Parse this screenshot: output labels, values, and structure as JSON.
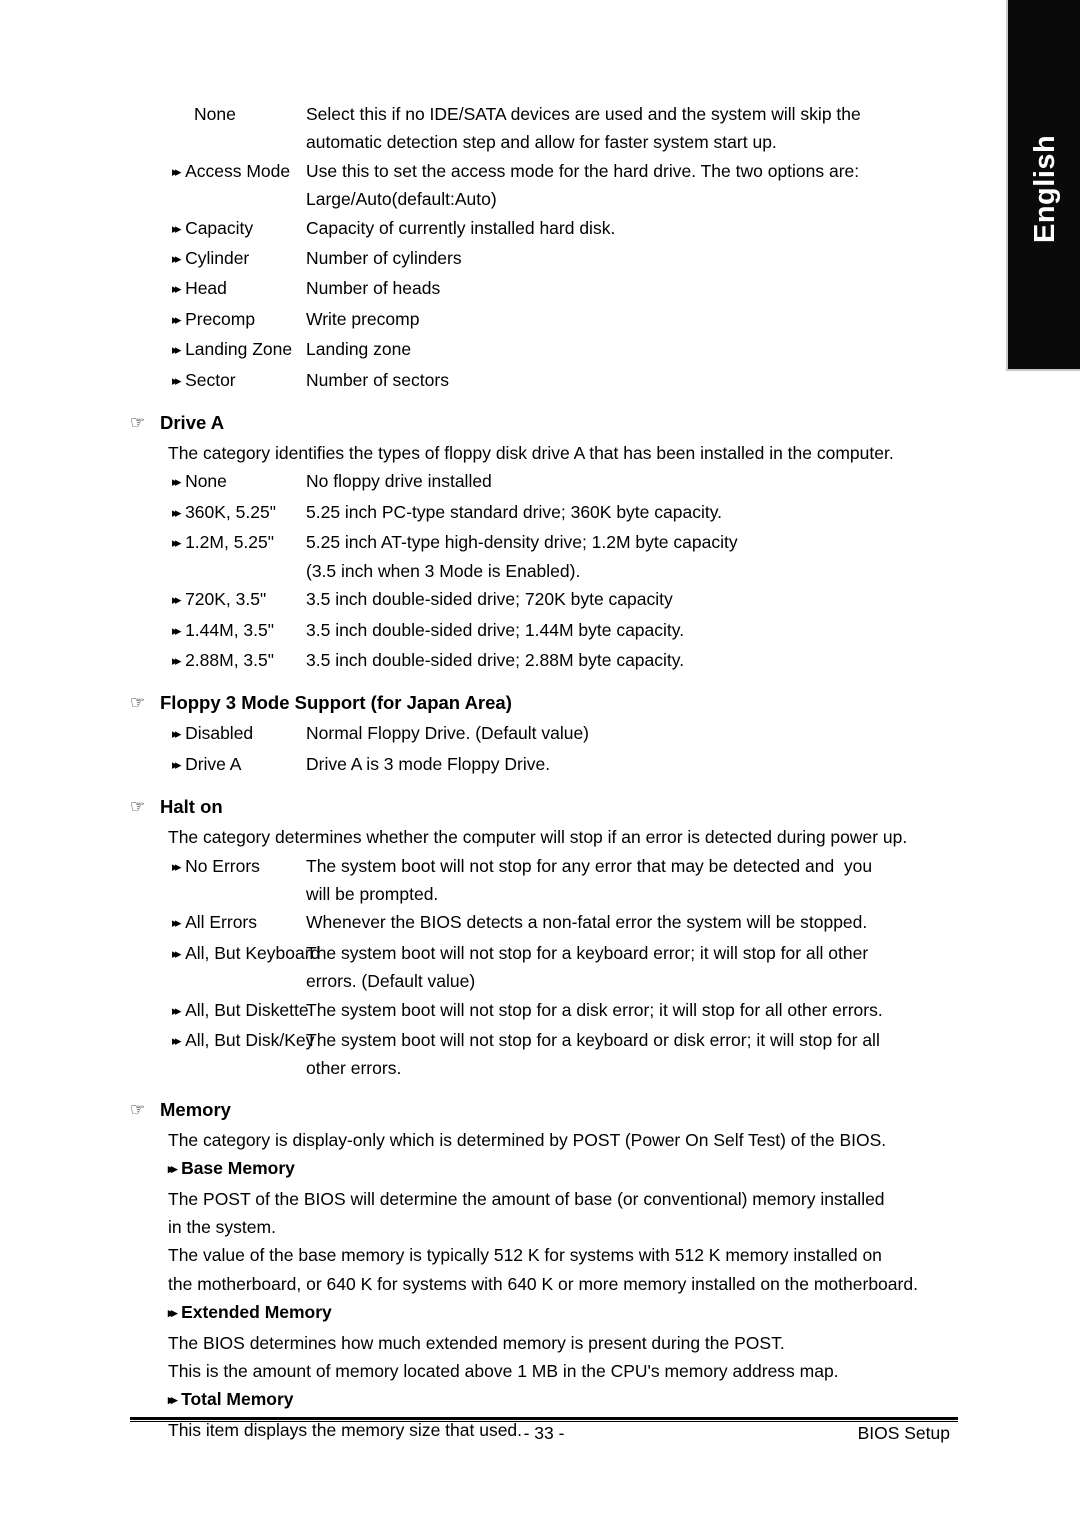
{
  "language_tab": {
    "label": "English"
  },
  "icons": {
    "section_marker": "☞",
    "sub_marker": "▸▸"
  },
  "ide_options": {
    "rows": [
      {
        "term": "None",
        "has_arrow": false,
        "desc": "Select this if no IDE/SATA devices are used and the system will skip the\nautomatic detection step and allow for faster system start up."
      },
      {
        "term": "Access Mode",
        "has_arrow": true,
        "desc": "Use this to set the access mode for the hard drive. The two options are:\nLarge/Auto(default:Auto)"
      },
      {
        "term": "Capacity",
        "has_arrow": true,
        "desc": "Capacity of currently installed hard disk."
      },
      {
        "term": "Cylinder",
        "has_arrow": true,
        "desc": "Number of cylinders"
      },
      {
        "term": "Head",
        "has_arrow": true,
        "desc": "Number of heads"
      },
      {
        "term": "Precomp",
        "has_arrow": true,
        "desc": "Write precomp"
      },
      {
        "term": "Landing Zone",
        "has_arrow": true,
        "desc": "Landing zone"
      },
      {
        "term": "Sector",
        "has_arrow": true,
        "desc": "Number of sectors"
      }
    ]
  },
  "drive_a": {
    "heading": "Drive A",
    "intro": "The category identifies the types of floppy disk drive A that has been installed in the computer.",
    "rows": [
      {
        "term": "None",
        "desc": "No floppy drive installed"
      },
      {
        "term": "360K, 5.25\"",
        "desc": "5.25 inch PC-type standard drive; 360K byte capacity."
      },
      {
        "term": "1.2M, 5.25\"",
        "desc": "5.25 inch AT-type high-density drive; 1.2M byte capacity\n(3.5 inch when 3 Mode is Enabled)."
      },
      {
        "term": "720K, 3.5\"",
        "desc": "3.5 inch double-sided drive; 720K byte capacity"
      },
      {
        "term": "1.44M, 3.5\"",
        "desc": "3.5 inch double-sided drive; 1.44M byte capacity."
      },
      {
        "term": "2.88M, 3.5\"",
        "desc": "3.5 inch double-sided drive; 2.88M byte capacity."
      }
    ]
  },
  "floppy_3_mode": {
    "heading": "Floppy 3 Mode Support (for Japan Area)",
    "rows": [
      {
        "term": "Disabled",
        "desc": "Normal Floppy Drive. (Default value)"
      },
      {
        "term": "Drive A",
        "desc": "Drive A is 3 mode Floppy Drive."
      }
    ]
  },
  "halt_on": {
    "heading": "Halt on",
    "intro": "The category determines whether the computer will stop if an error is detected during power up.",
    "rows": [
      {
        "term": "No Errors",
        "desc": "The system boot will not stop for any error that may be detected and  you\nwill be prompted."
      },
      {
        "term": "All Errors",
        "desc": "Whenever the BIOS detects a non-fatal error the system will be stopped."
      },
      {
        "term": "All, But Keyboard",
        "desc": "The system boot will not stop for a keyboard error; it will stop for all other\nerrors. (Default value)"
      },
      {
        "term": "All, But Diskette",
        "desc": "The system boot will not stop for a disk error; it will stop for all other errors."
      },
      {
        "term": "All, But Disk/Key",
        "desc": "The system boot will not stop for a keyboard or disk error; it will stop for all\nother errors."
      }
    ]
  },
  "memory": {
    "heading": "Memory",
    "intro": "The category is display-only which is determined by POST (Power On Self Test) of the BIOS.",
    "subsections": [
      {
        "title": "Base Memory",
        "paragraphs": [
          "The POST of the BIOS will determine the amount of base (or conventional) memory installed\nin the system.",
          "The value of the base memory is typically 512 K for systems with 512 K memory installed on\nthe motherboard, or 640 K for systems with 640 K or more memory installed on the motherboard."
        ]
      },
      {
        "title": "Extended Memory",
        "paragraphs": [
          "The BIOS determines how much extended memory is present during the POST.",
          "This is the amount of memory located above 1 MB in the CPU's memory address map."
        ]
      },
      {
        "title": "Total Memory",
        "paragraphs": [
          "This item displays the memory size that used."
        ]
      }
    ]
  },
  "footer": {
    "page_number": "- 33 -",
    "section_label": "BIOS Setup"
  }
}
